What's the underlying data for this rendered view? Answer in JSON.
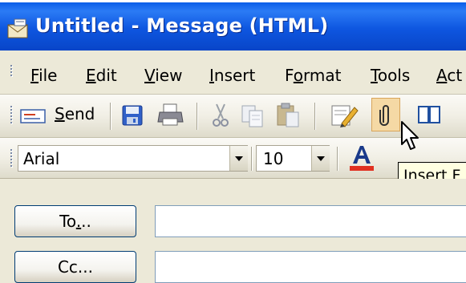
{
  "window": {
    "title": "Untitled - Message (HTML)"
  },
  "menubar": {
    "items": [
      {
        "label": "File",
        "accel_index": 0
      },
      {
        "label": "Edit",
        "accel_index": 0
      },
      {
        "label": "View",
        "accel_index": 0
      },
      {
        "label": "Insert",
        "accel_index": 0
      },
      {
        "label": "Format",
        "accel_index": 1
      },
      {
        "label": "Tools",
        "accel_index": 0
      },
      {
        "label": "Act",
        "accel_index": 0
      }
    ]
  },
  "toolbar": {
    "send_label": "Send",
    "icons": [
      "send-icon",
      "save-icon",
      "print-icon",
      "cut-icon",
      "copy-icon",
      "paste-icon",
      "signature-icon",
      "attach-file-icon",
      "address-book-icon"
    ]
  },
  "formatting": {
    "font_name": "Arial",
    "font_size": "10",
    "font_color": "#e03020"
  },
  "tooltip": {
    "text": "Insert F"
  },
  "address": {
    "to_label": "To...",
    "cc_label": "Cc..."
  },
  "colors": {
    "titlebar": "#0a5ee8",
    "chrome": "#ece9d8",
    "hover_highlight": "#f5d9a5"
  }
}
